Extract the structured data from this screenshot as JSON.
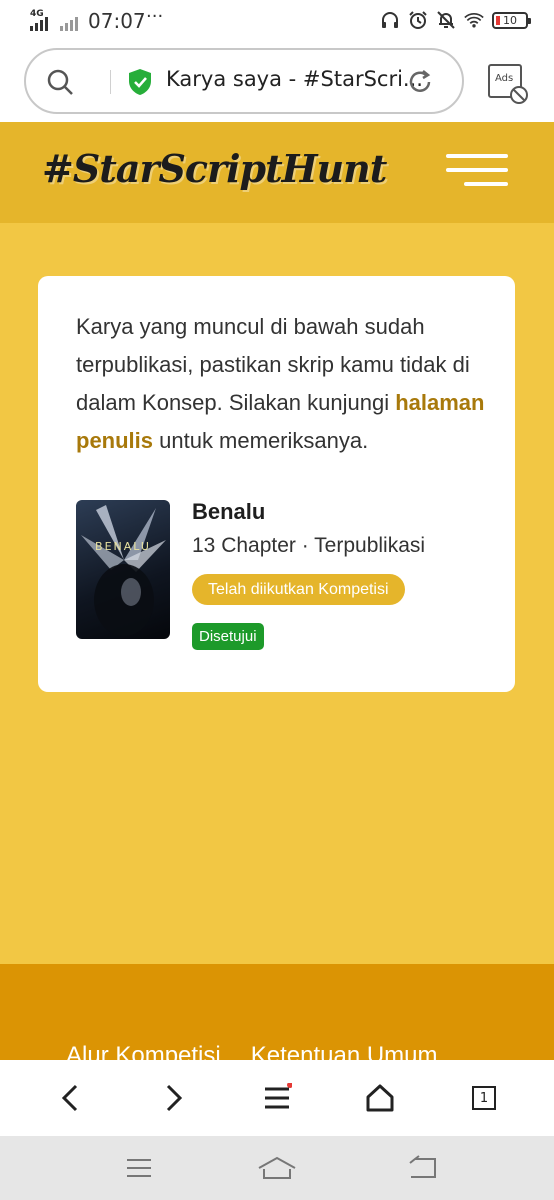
{
  "status_bar": {
    "network": "4G",
    "time": "07:07",
    "more": "···",
    "battery": "10",
    "icons": [
      "headphones-icon",
      "alarm-icon",
      "mute-icon",
      "wifi-icon",
      "battery-icon"
    ]
  },
  "browser": {
    "url_text": "Karya saya - #StarScri...",
    "ads_label": "Ads"
  },
  "site": {
    "logo": "#StarScriptHunt"
  },
  "card": {
    "message_pre": "Karya yang muncul di bawah sudah terpublikasi, pastikan skrip kamu tidak di dalam Konsep. Silakan kunjungi ",
    "message_link": "halaman penulis",
    "message_post": " untuk memeriksanya.",
    "book": {
      "cover_title": "BENALU",
      "title": "Benalu",
      "meta": "13 Chapter · Terpublikasi",
      "competition_badge": "Telah diikutkan Kompetisi",
      "status_badge": "Disetujui"
    }
  },
  "footer": {
    "links": [
      "Alur Kompetisi",
      "Ketentuan Umum"
    ]
  },
  "toolbar": {
    "tab_count": "1"
  },
  "colors": {
    "page_bg": "#f2c744",
    "header_bg": "#e5b52b",
    "footer_bg": "#db9404",
    "link": "#a8790b",
    "approved": "#1d9a2a"
  }
}
